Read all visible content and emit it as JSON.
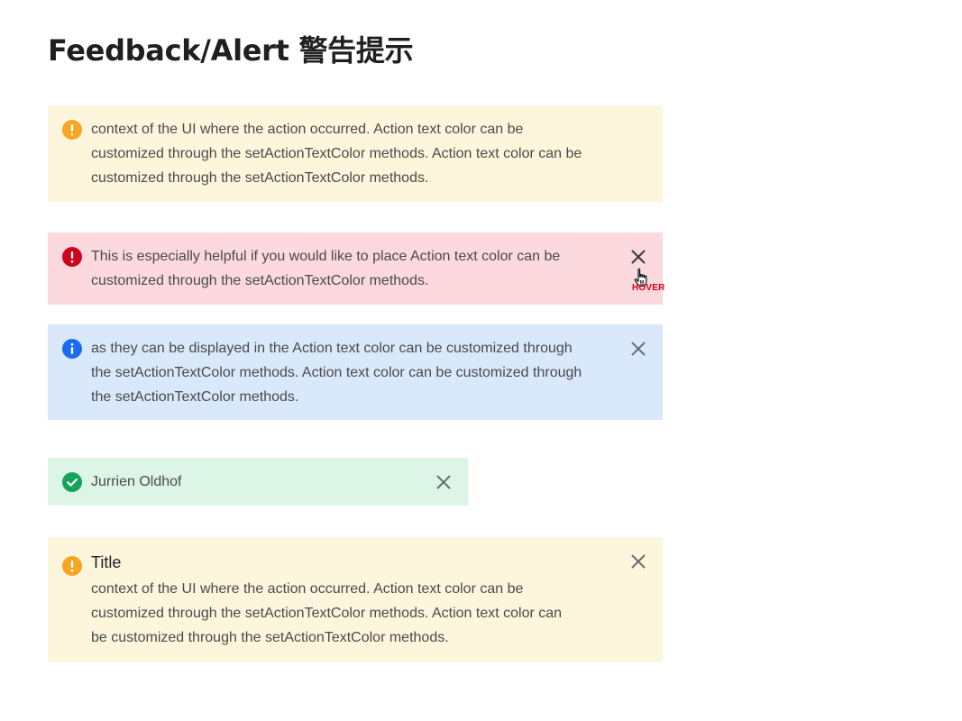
{
  "page": {
    "title": "Feedback/Alert 警告提示"
  },
  "colors": {
    "warning_bg": "#fdf5dc",
    "warning_icon": "#f5a623",
    "error_bg": "#fbd9de",
    "error_icon": "#d0021b",
    "info_bg": "#d9e8fb",
    "info_icon": "#1a6cf0",
    "success_bg": "#dcf5e7",
    "success_icon": "#14a35a",
    "hover_label": "#d0021b"
  },
  "alerts": [
    {
      "type": "warning",
      "icon": "warning-icon",
      "closable": false,
      "lines": [
        "context of the UI where the action occurred. Action text color can be",
        "customized through the setActionTextColor methods. Action text color can be",
        "customized through the setActionTextColor methods."
      ]
    },
    {
      "type": "error",
      "icon": "error-icon",
      "closable": true,
      "close_icon": "close-icon",
      "state": "hover",
      "lines": [
        "This is especially helpful if you would like to place Action text color can be",
        "customized through the setActionTextColor methods."
      ]
    },
    {
      "type": "info",
      "icon": "info-icon",
      "closable": true,
      "close_icon": "close-icon",
      "lines": [
        "as they can be displayed in the Action text color can be customized through",
        "the setActionTextColor methods. Action text color can be customized through",
        "the setActionTextColor methods."
      ]
    },
    {
      "type": "success",
      "icon": "check-circle-icon",
      "closable": true,
      "close_icon": "close-icon",
      "lines": [
        "Jurrien Oldhof"
      ]
    },
    {
      "type": "warning",
      "icon": "warning-icon",
      "closable": true,
      "close_icon": "close-icon",
      "title": "Title",
      "lines": [
        "context of the UI where the action occurred. Action text color can be",
        "customized through the setActionTextColor methods. Action text color can",
        "be customized through the setActionTextColor methods."
      ]
    }
  ],
  "annotation": {
    "hover_label": "HOVER",
    "cursor_icon": "hand-pointer-icon"
  }
}
